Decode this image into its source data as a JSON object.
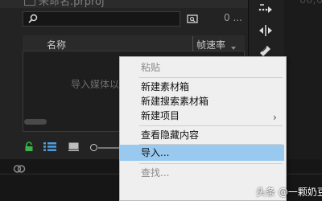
{
  "project_panel": {
    "title": "未命名.prproj",
    "item_count": "0 ..."
  },
  "list": {
    "col_name": "名称",
    "col_fps": "帧速率",
    "empty_hint": "导入媒体以开始"
  },
  "context_menu": {
    "items": [
      {
        "label": "粘贴",
        "enabled": false
      },
      {
        "label": "新建素材箱",
        "enabled": true
      },
      {
        "label": "新建搜索素材箱",
        "enabled": true
      },
      {
        "label": "新建项目",
        "enabled": true,
        "submenu": true
      },
      {
        "label": "查看隐藏内容",
        "enabled": true
      },
      {
        "label": "导入...",
        "enabled": true,
        "highlighted": true
      },
      {
        "label": "查找...",
        "enabled": false
      }
    ],
    "submenu_arrow": "›"
  },
  "right_edge": {
    "text": "00;0"
  },
  "watermark": {
    "text": "头条 @一颗奶豆"
  },
  "colors": {
    "highlight": "#99c9ef",
    "accent_green": "#3db24b",
    "accent_blue": "#4aa0e6"
  }
}
